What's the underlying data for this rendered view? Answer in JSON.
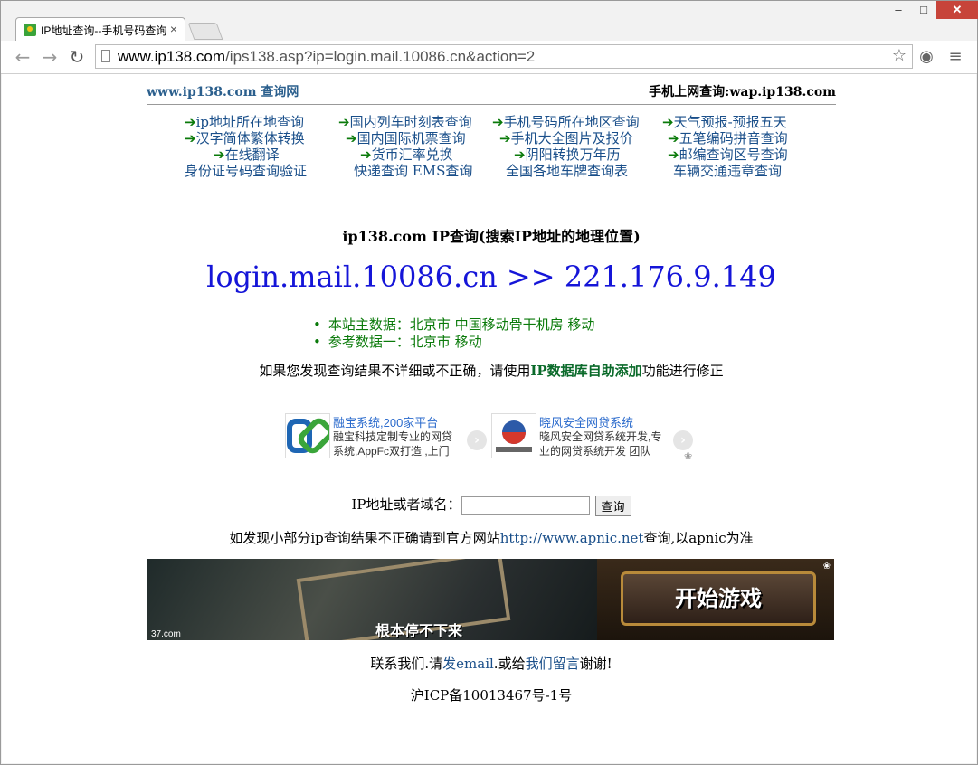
{
  "browser": {
    "tab_title": "IP地址查询--手机号码查询",
    "tab_close": "×",
    "url_host": "www.ip138.com",
    "url_path": "/ips138.asp?ip=login.mail.10086.cn&action=2",
    "window_min": "–",
    "window_max": "□",
    "window_close": "✕"
  },
  "header": {
    "site": "www.ip138.com 查询网",
    "mobile": "手机上网查询:wap.ip138.com"
  },
  "nav_links": [
    "ip地址所在地查询",
    "国内列车时刻表查询",
    "手机号码所在地区查询",
    "天气预报-预报五天",
    "汉字简体繁体转换",
    "国内国际机票查询",
    "手机大全图片及报价",
    "五笔编码拼音查询",
    "在线翻译",
    "货币汇率兑换",
    "阴阳转换万年历",
    "邮编查询区号查询",
    "身份证号码查询验证",
    "快递查询 EMS查询",
    "全国各地车牌查询表",
    "车辆交通违章查询"
  ],
  "arrow": "➔",
  "main": {
    "heading": "ip138.com IP查询(搜索IP地址的地理位置)",
    "result": "login.mail.10086.cn >> 221.176.9.149",
    "data_main": "本站主数据：北京市 中国移动骨干机房 移动",
    "data_ref": "参考数据一：北京市 移动",
    "fix_pre": "如果您发现查询结果不详细或不正确，请使用",
    "fix_link": "IP数据库自助添加",
    "fix_post": "功能进行修正"
  },
  "ads": [
    {
      "title": "融宝系统,200家平台",
      "desc": "融宝科技定制专业的网贷系统,AppFc双打造 ,上门"
    },
    {
      "title": "晓风安全网贷系统",
      "desc": "晓风安全网贷系统开发,专业的网贷系统开发 团队"
    }
  ],
  "search": {
    "label": "IP地址或者域名：",
    "value": "",
    "button": "查询"
  },
  "apnic": {
    "pre": "如发现小部分ip查询结果不正确请到官方网站",
    "link": "http://www.apnic.net",
    "post": "查询,以apnic为准"
  },
  "banner": {
    "caption": "根本停不下来",
    "brand": "37.com",
    "start": "开始游戏"
  },
  "footer": {
    "contact_pre": "联系我们.请",
    "email_link": "发email",
    "contact_mid": ".或给",
    "msg_link": "我们留言",
    "contact_post": "谢谢!",
    "icp": "沪ICP备10013467号-1号"
  }
}
